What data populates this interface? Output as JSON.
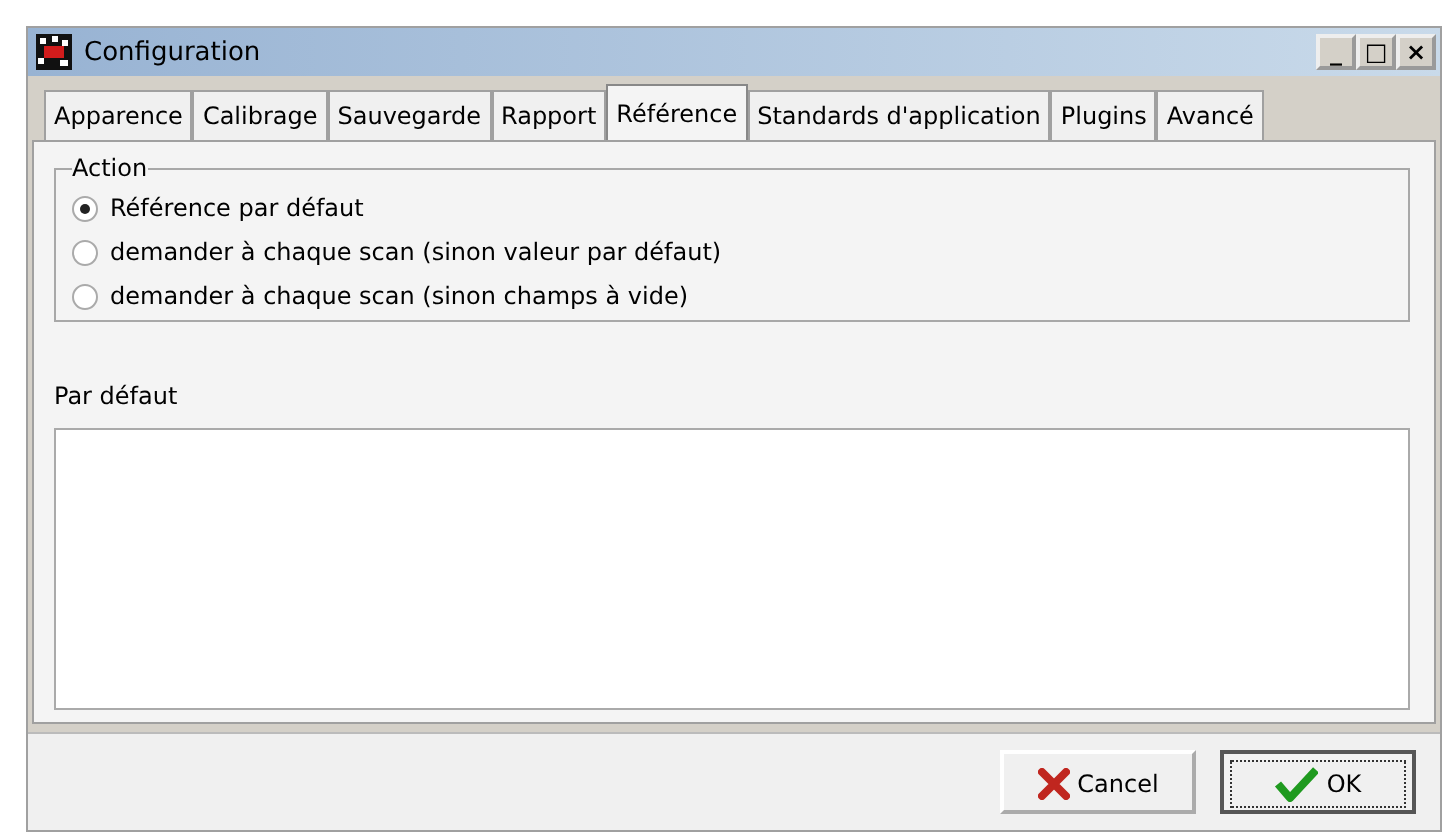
{
  "window": {
    "title": "Configuration",
    "controls": [
      "_",
      "□",
      "×"
    ]
  },
  "tabs": [
    {
      "label": "Apparence",
      "selected": false
    },
    {
      "label": "Calibrage",
      "selected": false
    },
    {
      "label": "Sauvegarde",
      "selected": false
    },
    {
      "label": "Rapport",
      "selected": false
    },
    {
      "label": "Référence",
      "selected": true
    },
    {
      "label": "Standards d'application",
      "selected": false
    },
    {
      "label": "Plugins",
      "selected": false
    },
    {
      "label": "Avancé",
      "selected": false
    }
  ],
  "action_group": {
    "title": "Action",
    "options": [
      {
        "label": "Référence par défaut",
        "selected": true
      },
      {
        "label": "demander à chaque scan (sinon valeur par défaut)",
        "selected": false
      },
      {
        "label": "demander à chaque scan (sinon champs à vide)",
        "selected": false
      }
    ]
  },
  "default_field": {
    "label": "Par défaut"
  },
  "buttons": [
    {
      "label": "Cancel",
      "kind": "cancel",
      "focused": false
    },
    {
      "label": "OK",
      "kind": "ok",
      "focused": true
    }
  ]
}
